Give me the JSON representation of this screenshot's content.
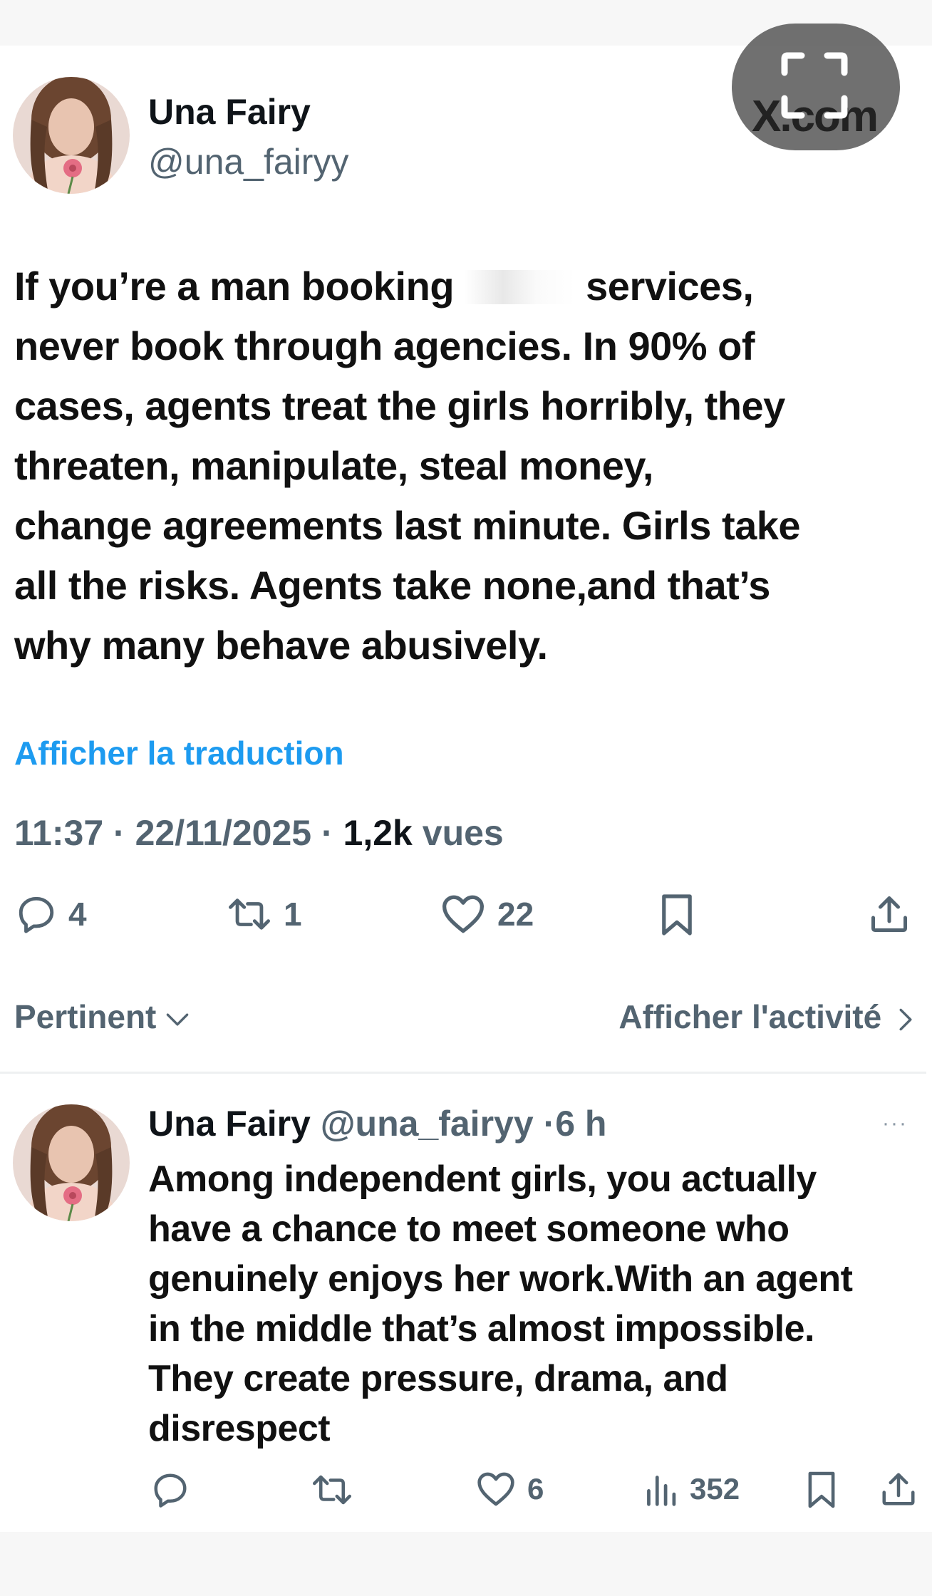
{
  "colors": {
    "accent": "#1d9bf0",
    "muted": "#536471",
    "text": "#0f1419"
  },
  "header": {
    "name": "Una Fairy",
    "handle": "@una_fairyy",
    "badge": "X.com",
    "badge_icon": "fullscreen-icon"
  },
  "tweet": {
    "lines": [
      "If you’re a man booking",
      "services,",
      "never book through agencies. In 90% of",
      "cases, agents treat the girls horribly, they",
      "threaten, manipulate, steal money,",
      "change agreements last minute. Girls take",
      "all the risks. Agents take none,and that’s",
      "why many behave abusively."
    ],
    "translate": "Afficher la traduction",
    "time": "11:37",
    "date": "22/11/2025",
    "views_count": "1,2k",
    "views_label": "vues",
    "actions": {
      "replies": "4",
      "reposts": "1",
      "likes": "22"
    }
  },
  "thread": {
    "sort_label": "Pertinent",
    "activity_label": "Afficher l'activité"
  },
  "reply": {
    "name": "Una Fairy",
    "handle": "@una_fairyy",
    "age": "6 h",
    "more": "···",
    "lines": [
      "Among independent girls, you actually",
      "have a chance to meet someone who",
      "genuinely enjoys her work.With an agent",
      "in the middle that’s almost impossible.",
      "They create pressure, drama, and",
      "disrespect"
    ],
    "actions": {
      "likes": "6",
      "views": "352"
    }
  }
}
